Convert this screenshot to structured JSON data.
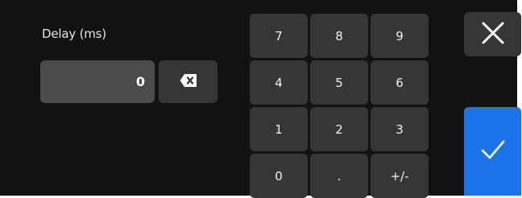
{
  "field": {
    "label": "Delay (ms)",
    "value": "0"
  },
  "keypad": {
    "keys": [
      "7",
      "8",
      "9",
      "4",
      "5",
      "6",
      "1",
      "2",
      "3",
      "0",
      ".",
      "+/-"
    ]
  },
  "icons": {
    "backspace": "backspace-icon",
    "close": "close-icon",
    "confirm": "checkmark-icon"
  },
  "colors": {
    "background": "#121212",
    "button": "#363636",
    "field": "#4b4b4b",
    "accent": "#1a73e8",
    "text": "#f0f0f0"
  }
}
